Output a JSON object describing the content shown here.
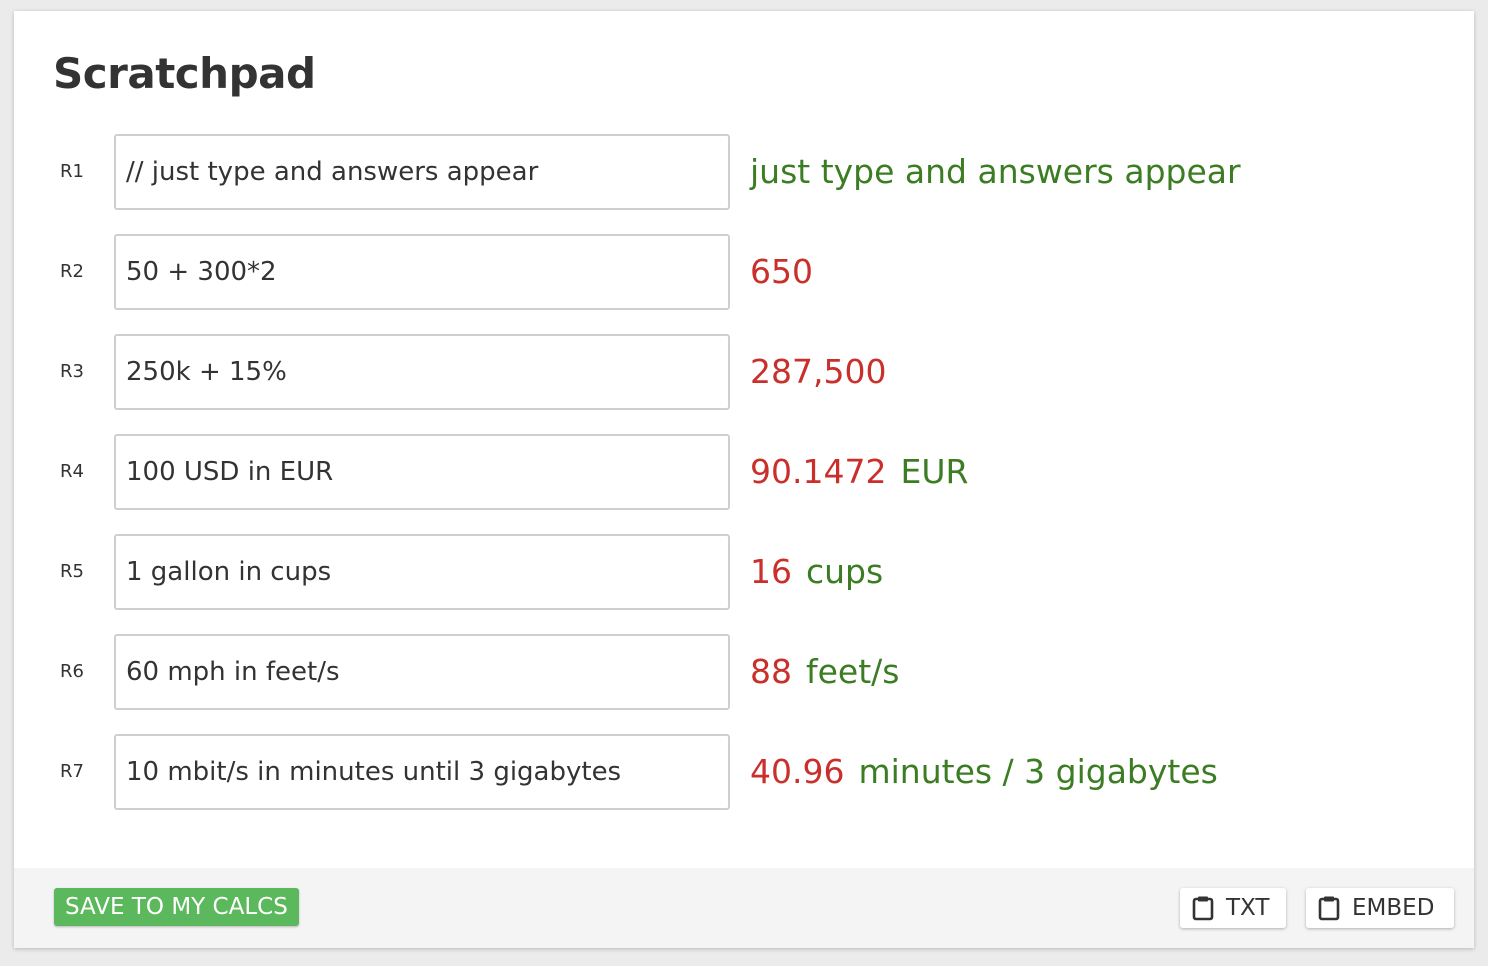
{
  "title": "Scratchpad",
  "rows": [
    {
      "label": "R1",
      "input": "// just type and answers appear",
      "result_number": "",
      "result_unit": "",
      "result_text": "just type and answers appear"
    },
    {
      "label": "R2",
      "input": "50 + 300*2",
      "result_number": "650",
      "result_unit": "",
      "result_text": ""
    },
    {
      "label": "R3",
      "input": "250k + 15%",
      "result_number": "287,500",
      "result_unit": "",
      "result_text": ""
    },
    {
      "label": "R4",
      "input": "100 USD in EUR",
      "result_number": "90.1472",
      "result_unit": "EUR",
      "result_text": ""
    },
    {
      "label": "R5",
      "input": "1 gallon in cups",
      "result_number": "16",
      "result_unit": "cups",
      "result_text": ""
    },
    {
      "label": "R6",
      "input": "60 mph in feet/s",
      "result_number": "88",
      "result_unit": "feet/s",
      "result_text": ""
    },
    {
      "label": "R7",
      "input": "10 mbit/s in minutes until 3 gigabytes",
      "result_number": "40.96",
      "result_unit": "minutes / 3 gigabytes",
      "result_text": ""
    }
  ],
  "footer": {
    "save_label": "SAVE TO MY CALCS",
    "txt_label": "TXT",
    "embed_label": "EMBED",
    "txt_icon": "clipboard-icon",
    "embed_icon": "clipboard-icon"
  },
  "colors": {
    "number": "#c9302c",
    "unit": "#3c7d24",
    "save_button": "#5cb85c"
  }
}
